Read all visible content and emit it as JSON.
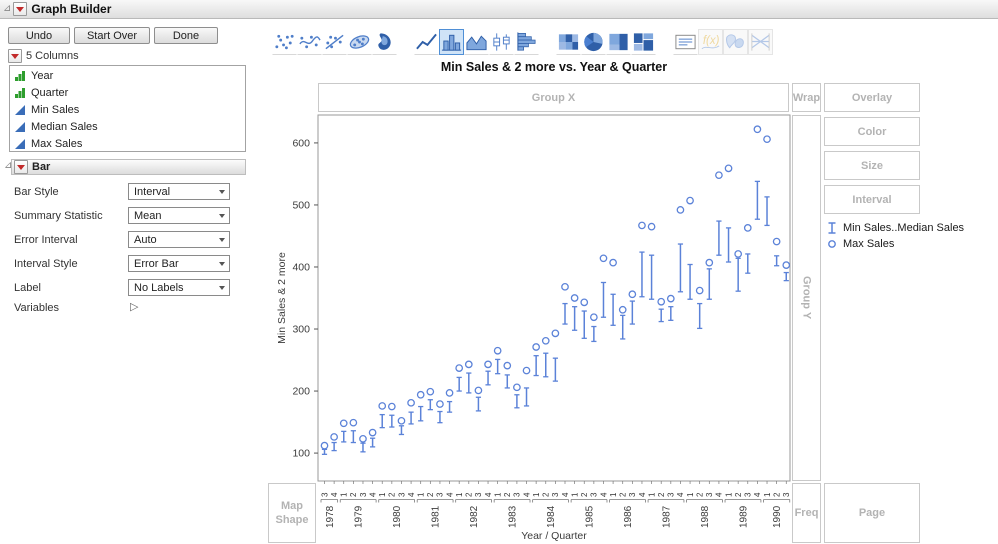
{
  "window": {
    "title": "Graph Builder"
  },
  "buttons": {
    "undo": "Undo",
    "start_over": "Start Over",
    "done": "Done"
  },
  "columns_panel": {
    "header": "5 Columns",
    "items": [
      {
        "name": "Year",
        "icon": "green-bars-icon"
      },
      {
        "name": "Quarter",
        "icon": "green-bars-icon"
      },
      {
        "name": "Min Sales",
        "icon": "blue-triangle-icon"
      },
      {
        "name": "Median Sales",
        "icon": "blue-triangle-icon"
      },
      {
        "name": "Max Sales",
        "icon": "blue-triangle-icon"
      }
    ]
  },
  "bar_panel": {
    "header": "Bar",
    "rows": [
      {
        "label": "Bar Style",
        "value": "Interval"
      },
      {
        "label": "Summary Statistic",
        "value": "Mean"
      },
      {
        "label": "Error Interval",
        "value": "Auto"
      },
      {
        "label": "Interval Style",
        "value": "Error Bar"
      },
      {
        "label": "Label",
        "value": "No Labels"
      }
    ],
    "variables_label": "Variables"
  },
  "element_palette": {
    "items": [
      {
        "name": "points",
        "selected": false,
        "enabled": true,
        "group_start": false
      },
      {
        "name": "smoother",
        "selected": false,
        "enabled": true,
        "group_start": false
      },
      {
        "name": "line-of-fit",
        "selected": false,
        "enabled": true,
        "group_start": false
      },
      {
        "name": "ellipse",
        "selected": false,
        "enabled": true,
        "group_start": false
      },
      {
        "name": "contour",
        "selected": false,
        "enabled": true,
        "group_start": false
      },
      {
        "name": "line",
        "selected": false,
        "enabled": true,
        "group_start": true
      },
      {
        "name": "bar",
        "selected": true,
        "enabled": true,
        "group_start": false
      },
      {
        "name": "area",
        "selected": false,
        "enabled": true,
        "group_start": false
      },
      {
        "name": "box-plot",
        "selected": false,
        "enabled": true,
        "group_start": false
      },
      {
        "name": "histogram",
        "selected": false,
        "enabled": true,
        "group_start": false
      },
      {
        "name": "heatmap",
        "selected": false,
        "enabled": true,
        "group_start": true
      },
      {
        "name": "pie",
        "selected": false,
        "enabled": true,
        "group_start": false
      },
      {
        "name": "treemap",
        "selected": false,
        "enabled": true,
        "group_start": false
      },
      {
        "name": "mosaic",
        "selected": false,
        "enabled": true,
        "group_start": false
      },
      {
        "name": "caption-box",
        "selected": false,
        "enabled": true,
        "group_start": true
      },
      {
        "name": "formula",
        "selected": false,
        "enabled": false,
        "group_start": false
      },
      {
        "name": "map-shape",
        "selected": false,
        "enabled": false,
        "group_start": false
      },
      {
        "name": "parallel-plot",
        "selected": false,
        "enabled": false,
        "group_start": false
      }
    ]
  },
  "drop_zones": {
    "group_x": "Group X",
    "wrap": "Wrap",
    "overlay": "Overlay",
    "color": "Color",
    "size": "Size",
    "interval": "Interval",
    "group_y": "Group Y",
    "map_shape": "Map Shape",
    "freq": "Freq",
    "page": "Page"
  },
  "legend": [
    {
      "icon": "interval-bar",
      "label": "Min Sales..Median Sales"
    },
    {
      "icon": "open-circle",
      "label": "Max Sales"
    }
  ],
  "colors": {
    "accent": "#5b82d8",
    "zone_border": "#c9c9c9",
    "zone_text": "#b3b3b3",
    "red_triangle": "#c22a2a",
    "green_icon": "#2e9e2e",
    "blue_icon": "#3a6db8"
  },
  "chart_data": {
    "type": "scatter",
    "title": "Min Sales & 2 more vs. Year & Quarter",
    "xlabel": "Year / Quarter",
    "ylabel": "Min Sales & 2 more",
    "ylim": [
      55,
      645
    ],
    "yticks": [
      100,
      200,
      300,
      400,
      500,
      600
    ],
    "grid": false,
    "legend_position": "right",
    "x_groups": [
      {
        "year": "1978",
        "quarters": [
          "3",
          "4"
        ]
      },
      {
        "year": "1979",
        "quarters": [
          "1",
          "2",
          "3",
          "4"
        ]
      },
      {
        "year": "1980",
        "quarters": [
          "1",
          "2",
          "3",
          "4"
        ]
      },
      {
        "year": "1981",
        "quarters": [
          "1",
          "2",
          "3",
          "4"
        ]
      },
      {
        "year": "1982",
        "quarters": [
          "1",
          "2",
          "3",
          "4"
        ]
      },
      {
        "year": "1983",
        "quarters": [
          "1",
          "2",
          "3",
          "4"
        ]
      },
      {
        "year": "1984",
        "quarters": [
          "1",
          "2",
          "3",
          "4"
        ]
      },
      {
        "year": "1985",
        "quarters": [
          "1",
          "2",
          "3",
          "4"
        ]
      },
      {
        "year": "1986",
        "quarters": [
          "1",
          "2",
          "3",
          "4"
        ]
      },
      {
        "year": "1987",
        "quarters": [
          "1",
          "2",
          "3",
          "4"
        ]
      },
      {
        "year": "1988",
        "quarters": [
          "1",
          "2",
          "3",
          "4"
        ]
      },
      {
        "year": "1989",
        "quarters": [
          "1",
          "2",
          "3",
          "4"
        ]
      },
      {
        "year": "1990",
        "quarters": [
          "1",
          "2",
          "3"
        ]
      }
    ],
    "series": [
      {
        "name": "Max Sales",
        "marker": "open-circle",
        "values": [
          112,
          126,
          148,
          149,
          123,
          133,
          176,
          175,
          152,
          181,
          194,
          199,
          179,
          197,
          237,
          243,
          201,
          243,
          265,
          241,
          206,
          233,
          271,
          281,
          293,
          368,
          350,
          343,
          319,
          414,
          407,
          331,
          356,
          467,
          465,
          344,
          349,
          492,
          507,
          362,
          407,
          548,
          559,
          421,
          463,
          622,
          606,
          441,
          403
        ]
      },
      {
        "name": "Min Sales..Median Sales",
        "marker": "error-bar",
        "upper": [
          106,
          117,
          135,
          136,
          116,
          124,
          162,
          161,
          144,
          166,
          175,
          186,
          167,
          183,
          222,
          229,
          190,
          232,
          251,
          226,
          194,
          205,
          257,
          261,
          253,
          341,
          336,
          329,
          304,
          375,
          356,
          322,
          345,
          424,
          419,
          332,
          336,
          437,
          404,
          341,
          397,
          474,
          463,
          414,
          421,
          538,
          513,
          418,
          391
        ],
        "lower": [
          98,
          104,
          118,
          117,
          102,
          110,
          141,
          142,
          130,
          147,
          152,
          170,
          149,
          166,
          200,
          197,
          168,
          210,
          228,
          205,
          173,
          176,
          225,
          223,
          216,
          308,
          298,
          285,
          280,
          319,
          306,
          284,
          308,
          352,
          348,
          312,
          314,
          360,
          348,
          301,
          348,
          419,
          408,
          361,
          390,
          477,
          467,
          402,
          378
        ]
      }
    ]
  }
}
